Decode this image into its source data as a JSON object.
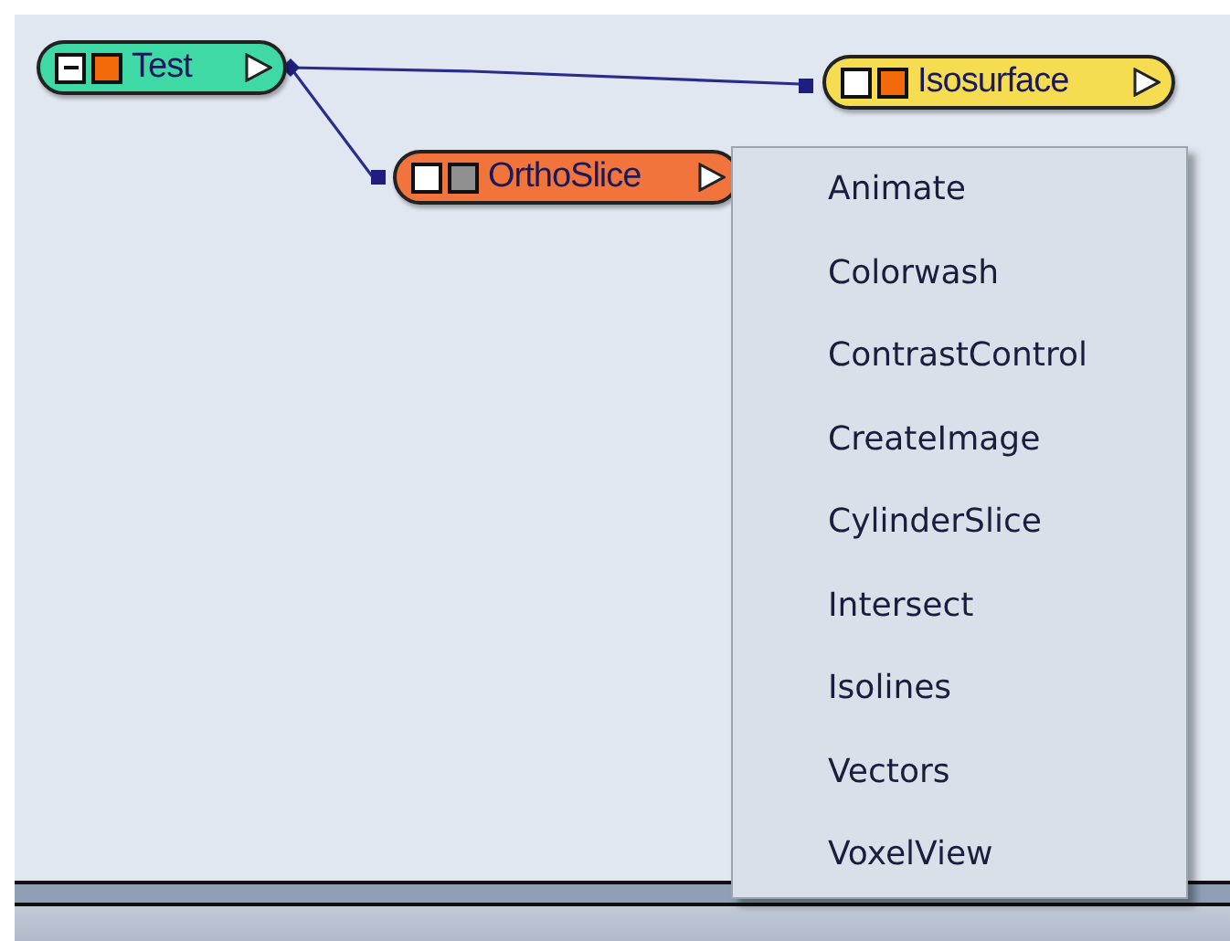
{
  "nodes": [
    {
      "label": "Test",
      "color": "#3fd9a5",
      "expanded": true,
      "swatch": {
        "color": "#f26a0a"
      }
    },
    {
      "label": "Isosurface",
      "color": "#f5dc50",
      "expanded": false,
      "swatch": {
        "color": "#f26a0a"
      }
    },
    {
      "label": "OrthoSlice",
      "color": "#f0743c",
      "expanded": false,
      "swatch": {
        "color": "#909090"
      }
    }
  ],
  "context_menu": {
    "items": [
      "Animate",
      "Colorwash",
      "ContrastControl",
      "CreateImage",
      "CylinderSlice",
      "Intersect",
      "Isolines",
      "Vectors",
      "VoxelView"
    ]
  }
}
